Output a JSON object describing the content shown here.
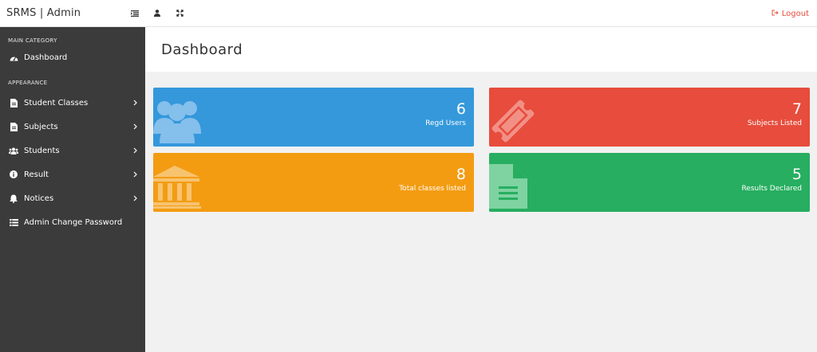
{
  "brand": "SRMS | Admin",
  "header": {
    "icons": [
      "menu-toggle-icon",
      "user-icon",
      "fullscreen-icon"
    ],
    "logout_label": "Logout"
  },
  "sidebar": {
    "main_category": "MAIN CATEGORY",
    "appearance_category": "APPEARANCE",
    "items": [
      {
        "label": "Dashboard",
        "icon": "dashboard-icon",
        "has_submenu": false
      },
      {
        "label": "Student Classes",
        "icon": "file-icon",
        "has_submenu": true
      },
      {
        "label": "Subjects",
        "icon": "file-icon",
        "has_submenu": true
      },
      {
        "label": "Students",
        "icon": "users-icon",
        "has_submenu": true
      },
      {
        "label": "Result",
        "icon": "info-icon",
        "has_submenu": true
      },
      {
        "label": "Notices",
        "icon": "bell-icon",
        "has_submenu": true
      },
      {
        "label": "Admin Change Password",
        "icon": "list-icon",
        "has_submenu": false
      }
    ]
  },
  "main": {
    "title": "Dashboard",
    "cards": [
      {
        "value": "6",
        "label": "Regd Users",
        "color": "#3498db",
        "icon": "users-icon"
      },
      {
        "value": "7",
        "label": "Subjects Listed",
        "color": "#e74c3c",
        "icon": "ticket-icon"
      },
      {
        "value": "8",
        "label": "Total classes listed",
        "color": "#f39c12",
        "icon": "bank-icon"
      },
      {
        "value": "5",
        "label": "Results Declared",
        "color": "#27ae60",
        "icon": "document-icon"
      }
    ]
  },
  "colors": {
    "sidebar_bg": "#3b3b3b",
    "logout": "#e74c3c"
  }
}
